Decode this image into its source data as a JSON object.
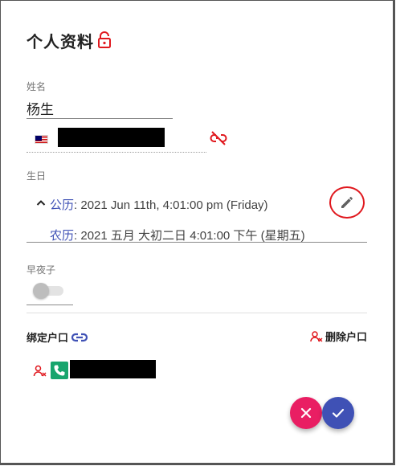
{
  "header": {
    "title": "个人资料",
    "lock_icon": "unlocked-padlock-icon",
    "lock_color": "#e0181e"
  },
  "name_field": {
    "label": "姓名",
    "value": "杨生"
  },
  "phone_field": {
    "country_flag": "malaysia-flag-icon",
    "value_redacted": true,
    "unlink_icon": "link-off-icon"
  },
  "birthday": {
    "label": "生日",
    "gregorian_label": "公历",
    "gregorian_value": ": 2021 Jun 11th, 4:01:00 pm (Friday)",
    "lunar_label": "农历",
    "lunar_value": ": 2021 五月 大初二日 4:01:00 下午 (星期五)",
    "edit_icon": "pencil-icon"
  },
  "twin": {
    "label": "早夜子",
    "toggle_on": false
  },
  "linked_accounts": {
    "title": "绑定户口",
    "link_icon": "link-icon",
    "remove_label": "删除户口",
    "remove_icon": "remove-user-icon",
    "items": [
      {
        "type_icon": "phone-icon",
        "value_redacted": true
      }
    ]
  },
  "actions": {
    "cancel_icon": "close-icon",
    "confirm_icon": "check-icon"
  },
  "colors": {
    "accent_blue": "#3f51b5",
    "danger_red": "#e0181e",
    "cancel_pink": "#e91e63",
    "phone_green": "#17a56d"
  }
}
